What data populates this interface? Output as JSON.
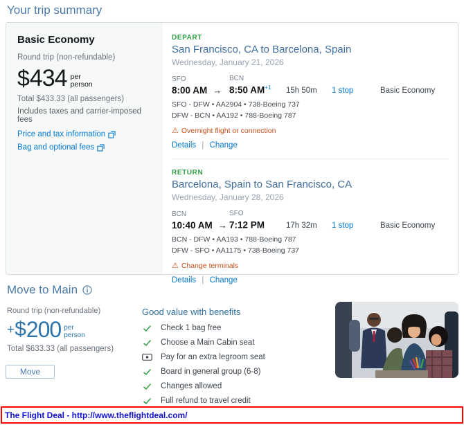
{
  "page": {
    "title": "Your trip summary"
  },
  "colors": {
    "heading_blue": "#4c7aa8",
    "link_blue": "#0078d2",
    "direction_green": "#2f9e44",
    "warning_orange": "#c9501a",
    "price_blue": "#2f74a8",
    "banner_border_red": "#ff0000",
    "banner_text_blue": "#1111d6"
  },
  "summary_card": {
    "fare": {
      "name": "Basic Economy",
      "trip_type": "Round trip (non-refundable)",
      "currency": "$",
      "price": "434",
      "per_line1": "per",
      "per_line2": "person",
      "total": "Total $433.33 (all passengers)",
      "includes": "Includes taxes and carrier-imposed fees",
      "price_tax_link": "Price and tax information",
      "bag_fees_link": "Bag and optional fees"
    },
    "slices": [
      {
        "direction": "DEPART",
        "route": "San Francisco, CA to Barcelona, Spain",
        "date": "Wednesday, January 21, 2026",
        "depart_code": "SFO",
        "arrive_code": "BCN",
        "depart_time": "8:00 AM",
        "arrive_time": "8:50 AM",
        "arrive_suffix": "+1",
        "duration": "15h 50m",
        "stops": "1 stop",
        "cabin": "Basic Economy",
        "segments": [
          "SFO - DFW • AA2904 • 738-Boeing 737",
          "DFW - BCN • AA192 • 788-Boeing 787"
        ],
        "warning": "Overnight flight or connection",
        "details_label": "Details",
        "change_label": "Change"
      },
      {
        "direction": "RETURN",
        "route": "Barcelona, Spain to San Francisco, CA",
        "date": "Wednesday, January 28, 2026",
        "depart_code": "BCN",
        "arrive_code": "SFO",
        "depart_time": "10:40 AM",
        "arrive_time": "7:12 PM",
        "arrive_suffix": "",
        "duration": "17h 32m",
        "stops": "1 stop",
        "cabin": "Basic Economy",
        "segments": [
          "BCN - DFW • AA193 • 788-Boeing 787",
          "DFW - SFO • AA1175 • 738-Boeing 737"
        ],
        "warning": "Change terminals",
        "details_label": "Details",
        "change_label": "Change"
      }
    ]
  },
  "upsell": {
    "title": "Move to Main",
    "trip_type": "Round trip (non-refundable)",
    "plus": "+",
    "currency": "$",
    "price": "200",
    "per_line1": "per",
    "per_line2": "person",
    "total": "Total $633.33 (all passengers)",
    "move_button": "Move",
    "benefits_title": "Good value with benefits",
    "benefits": [
      {
        "icon": "check-icon",
        "label": "Check 1 bag free"
      },
      {
        "icon": "check-icon",
        "label": "Choose a Main Cabin seat"
      },
      {
        "icon": "money-icon",
        "label": "Pay for an extra legroom seat"
      },
      {
        "icon": "check-icon",
        "label": "Board in general group (6-8)"
      },
      {
        "icon": "check-icon",
        "label": "Changes allowed"
      },
      {
        "icon": "check-icon",
        "label": "Full refund to travel credit"
      }
    ]
  },
  "footer_banner": {
    "text": "The Flight Deal - http://www.theflightdeal.com/"
  }
}
